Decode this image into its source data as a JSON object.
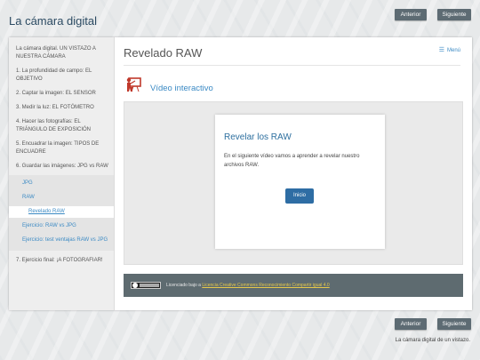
{
  "site": {
    "title": "La cámara digital"
  },
  "top_nav": {
    "prev_label": "Anterior",
    "next_label": "Siguiente"
  },
  "sidebar": {
    "items": [
      {
        "label": "La cámara digital. UN VISTAZO A NUESTRA CÁMARA"
      },
      {
        "label": "1. La profundidad de campo: EL OBJETIVO"
      },
      {
        "label": "2. Captar la imagen: EL SENSOR"
      },
      {
        "label": "3. Medir la luz: EL FOTÓMETRO"
      },
      {
        "label": "4. Hacer las fotografías: EL TRIÁNGULO DE EXPOSICIÓN"
      },
      {
        "label": "5. Encuadrar la imagen: TIPOS DE ENCUADRE"
      },
      {
        "label": "6. Guardar las imágenes: JPG vs RAW"
      }
    ],
    "subitems": [
      {
        "label": "JPG"
      },
      {
        "label": "RAW"
      },
      {
        "label": "Revelado RAW"
      },
      {
        "label": "Ejercicio: RAW vs JPG"
      },
      {
        "label": "Ejercicio: test ventajas RAW vs JPG"
      }
    ],
    "last_item": {
      "label": "7. Ejercicio final: ¡A FOTOGRAFIAR!"
    }
  },
  "main": {
    "page_title": "Revelado RAW",
    "menu_label": "Menú",
    "idevice_title": "Vídeo interactivo",
    "card": {
      "title": "Revelar los RAW",
      "text": "En el siguiente vídeo vamos a aprender a revelar nuestro archivos RAW.",
      "button": "Inicio"
    },
    "license": {
      "prefix": "Licenciado bajo a ",
      "link": "Licencia Creative Commons Reconocimiento Compartir igual 4.0"
    }
  },
  "bottom_nav": {
    "prev_label": "Anterior",
    "next_label": "Siguiente"
  },
  "footer": {
    "text": "La cámara digital de un vistazo."
  },
  "colors": {
    "accent": "#3b8ac4",
    "button": "#2e6da4",
    "nav_button": "#5d6b73",
    "license_bar": "#5e6b70"
  }
}
